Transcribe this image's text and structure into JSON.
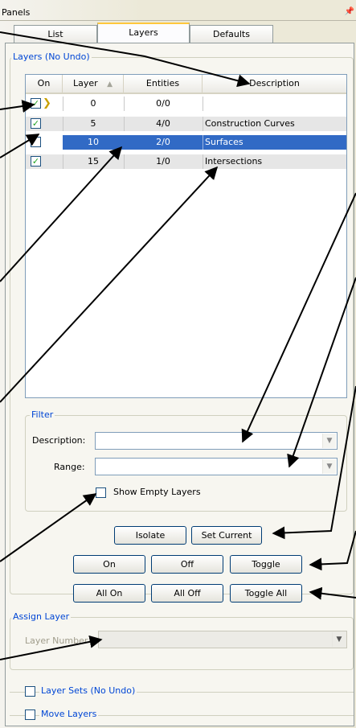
{
  "panel": {
    "title": "Panels",
    "pin_icon": "pin-icon"
  },
  "tabs": [
    {
      "label": "List",
      "active": false
    },
    {
      "label": "Layers",
      "active": true
    },
    {
      "label": "Defaults",
      "active": false
    }
  ],
  "layers_group": {
    "title": "Layers (No Undo)"
  },
  "columns": {
    "on": "On",
    "layer": "Layer",
    "entities": "Entities",
    "description": "Description"
  },
  "rows": [
    {
      "on": true,
      "current": true,
      "layer": "0",
      "entities": "0/0",
      "description": "",
      "selected": false
    },
    {
      "on": true,
      "current": false,
      "layer": "5",
      "entities": "4/0",
      "description": "Construction Curves",
      "selected": false
    },
    {
      "on": false,
      "current": false,
      "layer": "10",
      "entities": "2/0",
      "description": "Surfaces",
      "selected": true
    },
    {
      "on": true,
      "current": false,
      "layer": "15",
      "entities": "1/0",
      "description": "Intersections",
      "selected": false
    }
  ],
  "filter": {
    "title": "Filter",
    "description_label": "Description:",
    "description_value": "",
    "range_label": "Range:",
    "range_value": "",
    "show_empty_label": "Show Empty Layers",
    "show_empty_checked": false
  },
  "buttons": {
    "isolate": "Isolate",
    "set_current": "Set Current",
    "on": "On",
    "off": "Off",
    "toggle": "Toggle",
    "all_on": "All On",
    "all_off": "All Off",
    "toggle_all": "Toggle All"
  },
  "assign": {
    "title": "Assign Layer",
    "layer_number_label": "Layer Number",
    "layer_number_value": ""
  },
  "layer_sets": {
    "label": "Layer Sets (No Undo)",
    "checked": false
  },
  "move_layers": {
    "label": "Move Layers",
    "checked": false
  },
  "colors": {
    "selection": "#316ac5",
    "legend": "#0046d5",
    "check": "#21a121",
    "current_marker": "#c8a000"
  }
}
